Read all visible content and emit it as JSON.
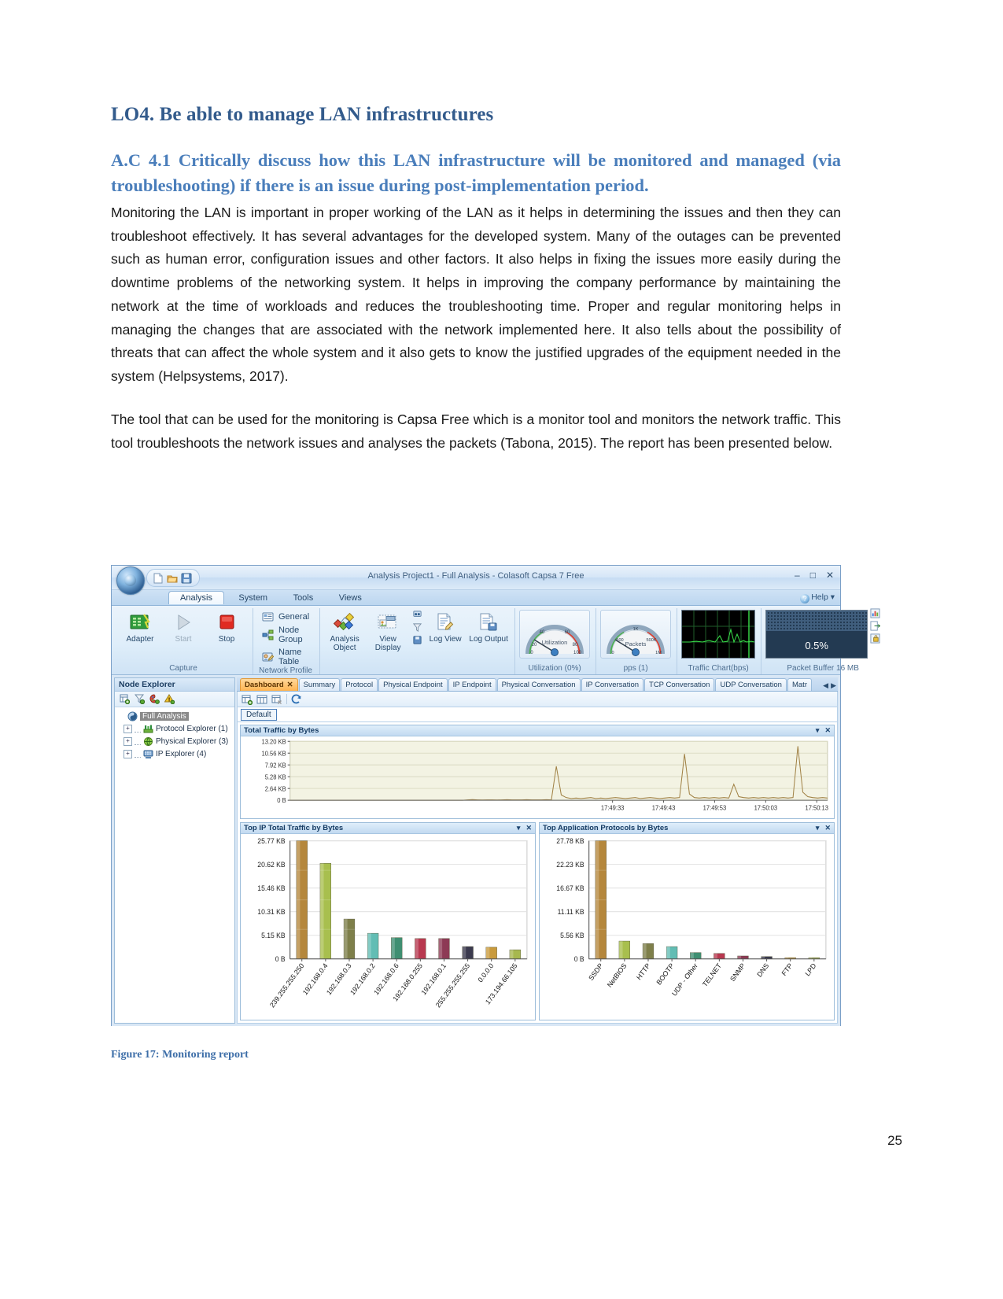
{
  "document": {
    "heading": "LO4. Be able to manage LAN infrastructures",
    "subheading": "A.C 4.1 Critically discuss how this LAN infrastructure will be monitored and managed (via troubleshooting) if there is an issue during post-implementation period.",
    "paragraph1": "Monitoring the LAN is important in proper working of the LAN as it helps in determining the issues and then they can troubleshoot effectively. It has several advantages for the developed system. Many of the outages can be prevented such as human error, configuration issues and other factors.  It also helps in fixing the issues more easily during the downtime problems of the networking system. It helps in improving the company performance by maintaining the network at the time of workloads and reduces the troubleshooting time. Proper and regular monitoring helps in managing the changes that are associated with the network implemented here. It also tells about the possibility of threats that can affect the whole system and it also gets to know the justified upgrades of the equipment needed in the system (Helpsystems, 2017).",
    "paragraph2": "The tool that can be used for the monitoring is Capsa Free which is a monitor tool and monitors the network traffic. This tool troubleshoots the network issues and analyses the packets (Tabona, 2015). The report has been presented below.",
    "figure_caption": "Figure 17: Monitoring report",
    "page_number": "25",
    "heading_color": "#335b8c",
    "subheading_color": "#4a7ebb",
    "caption_color": "#3d6ea8"
  },
  "app": {
    "window_title": "Analysis Project1 - Full Analysis - Colasoft Capsa 7 Free",
    "window_buttons": [
      "minimize",
      "maximize",
      "close"
    ],
    "quick_access": [
      "new-icon",
      "open-icon",
      "save-icon"
    ],
    "help_label": "Help",
    "ribbon_tabs": [
      {
        "label": "Analysis",
        "active": true
      },
      {
        "label": "System",
        "active": false
      },
      {
        "label": "Tools",
        "active": false
      },
      {
        "label": "Views",
        "active": false
      }
    ],
    "ribbon_groups": [
      {
        "label": "Capture",
        "items": [
          {
            "label": "Adapter",
            "icon": "adapter-icon",
            "disabled": false
          },
          {
            "label": "Start",
            "icon": "play-icon",
            "disabled": true
          },
          {
            "label": "Stop",
            "icon": "stop-icon",
            "disabled": false
          }
        ]
      },
      {
        "label": "Network Profile Settings",
        "menu": [
          {
            "label": "General",
            "icon": "general-icon"
          },
          {
            "label": "Node Group",
            "icon": "node-group-icon"
          },
          {
            "label": "Name Table",
            "icon": "name-table-icon"
          }
        ]
      },
      {
        "label": "",
        "items": [
          {
            "label": "Analysis Object",
            "icon": "analysis-object-icon"
          },
          {
            "label": "View Display",
            "icon": "view-display-icon"
          },
          {
            "label": "Log View",
            "icon": "log-view-icon"
          },
          {
            "label": "Log Output",
            "icon": "log-output-icon"
          }
        ]
      }
    ],
    "gauges": [
      {
        "label": "Utilization (0%)",
        "title": "Utilization",
        "ticks": [
          "0",
          "20",
          "40",
          "60",
          "80",
          "100"
        ],
        "value": 0
      },
      {
        "label": "pps (1)",
        "title": "Packets",
        "ticks": [
          "0",
          "500",
          "1K",
          "500K",
          "1M"
        ],
        "value": 1
      }
    ],
    "traffic_chart_label": "Traffic Chart(bps)",
    "packet_buffer_label": "Packet Buffer 16 MB",
    "packet_buffer_value": "0.5%"
  },
  "explorer": {
    "title": "Node Explorer",
    "toolbar_icons": [
      "add-node-icon",
      "filter-icon",
      "color-icon",
      "alarm-icon"
    ],
    "tree": [
      {
        "label": "Full Analysis",
        "icon": "full-analysis-icon",
        "selected": true,
        "level": 0,
        "expandable": false
      },
      {
        "label": "Protocol Explorer (1)",
        "icon": "protocol-icon",
        "selected": false,
        "level": 1,
        "expandable": true
      },
      {
        "label": "Physical Explorer (3)",
        "icon": "physical-icon",
        "selected": false,
        "level": 1,
        "expandable": true
      },
      {
        "label": "IP Explorer (4)",
        "icon": "ip-icon",
        "selected": false,
        "level": 1,
        "expandable": true
      }
    ]
  },
  "main": {
    "tabs": [
      {
        "label": "Dashboard",
        "active": true,
        "closable": true
      },
      {
        "label": "Summary",
        "active": false,
        "closable": false
      },
      {
        "label": "Protocol",
        "active": false,
        "closable": false
      },
      {
        "label": "Physical Endpoint",
        "active": false,
        "closable": false
      },
      {
        "label": "IP Endpoint",
        "active": false,
        "closable": false
      },
      {
        "label": "Physical Conversation",
        "active": false,
        "closable": false
      },
      {
        "label": "IP Conversation",
        "active": false,
        "closable": false
      },
      {
        "label": "TCP Conversation",
        "active": false,
        "closable": false
      },
      {
        "label": "UDP Conversation",
        "active": false,
        "closable": false
      },
      {
        "label": "Matr",
        "active": false,
        "closable": false
      }
    ],
    "toolbar_icons": [
      "add-chart-icon",
      "edit-chart-icon",
      "delete-chart-icon",
      "refresh-icon"
    ],
    "profile_name": "Default"
  },
  "chart_data": [
    {
      "type": "line",
      "title": "Total Traffic by Bytes",
      "ylabel": "",
      "xlabel": "",
      "yticks": [
        "0 B",
        "2.64 KB",
        "5.28 KB",
        "7.92 KB",
        "10.56 KB",
        "13.20 KB"
      ],
      "ylim": [
        0,
        13.2
      ],
      "xticks": [
        "17:49:33",
        "17:49:43",
        "17:49:53",
        "17:50:03",
        "17:50:13"
      ],
      "series": [
        {
          "name": "Total Traffic",
          "color": "#a08144",
          "values": [
            0,
            0,
            0,
            0,
            0,
            0,
            0,
            0,
            0,
            0,
            0,
            0,
            0,
            0,
            0,
            0,
            0,
            0,
            0,
            0,
            0,
            0,
            0,
            0,
            0,
            0,
            0,
            0,
            0,
            0,
            0,
            0,
            0,
            0,
            0,
            0,
            0.1,
            0.15,
            0.1,
            0.05,
            0.1,
            0.08,
            0.05,
            0.1,
            0.12,
            0.1,
            0.08,
            0.1,
            0.12,
            0.1,
            0.08,
            0.1,
            0.12,
            0.1,
            7.6,
            1.2,
            0.6,
            0.4,
            0.5,
            0.4,
            0.5,
            0.6,
            0.4,
            0.5,
            0.4,
            0.5,
            0.6,
            0.5,
            0.4,
            0.5,
            0.6,
            0.4,
            0.5,
            0.6,
            0.5,
            0.4,
            0.5,
            0.6,
            0.5,
            0.6,
            10.4,
            1.4,
            0.6,
            0.5,
            0.6,
            0.5,
            0.6,
            0.5,
            0.6,
            0.5,
            3.6,
            0.8,
            0.6,
            0.5,
            0.6,
            0.5,
            0.6,
            0.5,
            0.6,
            0.5,
            0.6,
            0.5,
            0.6,
            12.1,
            1.8,
            0.8,
            0.6,
            0.5,
            0.6,
            0.5
          ]
        }
      ],
      "grid": true,
      "background": "#f3f3e3"
    },
    {
      "type": "bar",
      "title": "Top IP Total Traffic by Bytes",
      "categories": [
        "239.255.255.250",
        "192.168.0.4",
        "192.168.0.3",
        "192.168.0.2",
        "192.168.0.6",
        "192.168.0.255",
        "192.168.0.1",
        "255.255.255.255",
        "0.0.0.0",
        "173.194.66.105"
      ],
      "values": [
        25.77,
        20.85,
        8.7,
        5.6,
        4.65,
        4.45,
        4.45,
        2.7,
        2.55,
        2.0
      ],
      "unit": "KB",
      "colors": [
        "#b5873c",
        "#a8bf4e",
        "#7e7f4a",
        "#62bdb4",
        "#3f8f72",
        "#b8384f",
        "#8d3a55",
        "#3b3a4e",
        "#c99a3c",
        "#a7b84e"
      ],
      "yticks": [
        "0 B",
        "5.15 KB",
        "10.31 KB",
        "15.46 KB",
        "20.62 KB",
        "25.77 KB"
      ],
      "ylim": [
        0,
        25.77
      ],
      "grid": true
    },
    {
      "type": "bar",
      "title": "Top Application Protocols by Bytes",
      "categories": [
        "SSDP",
        "NetBIOS",
        "HTTP",
        "BOOTP",
        "UDP - Other",
        "TELNET",
        "SNMP",
        "DNS",
        "FTP",
        "LPD"
      ],
      "values": [
        27.78,
        4.2,
        3.6,
        2.9,
        1.5,
        1.3,
        0.7,
        0.55,
        0.3,
        0.3
      ],
      "unit": "KB",
      "colors": [
        "#b5873c",
        "#a8bf4e",
        "#7e7f4a",
        "#62bdb4",
        "#3f8f72",
        "#b8384f",
        "#8d3a55",
        "#3b3a4e",
        "#c99a3c",
        "#a7b84e"
      ],
      "yticks": [
        "0 B",
        "5.56 KB",
        "11.11 KB",
        "16.67 KB",
        "22.23 KB",
        "27.78 KB"
      ],
      "ylim": [
        0,
        27.78
      ],
      "grid": true
    }
  ]
}
